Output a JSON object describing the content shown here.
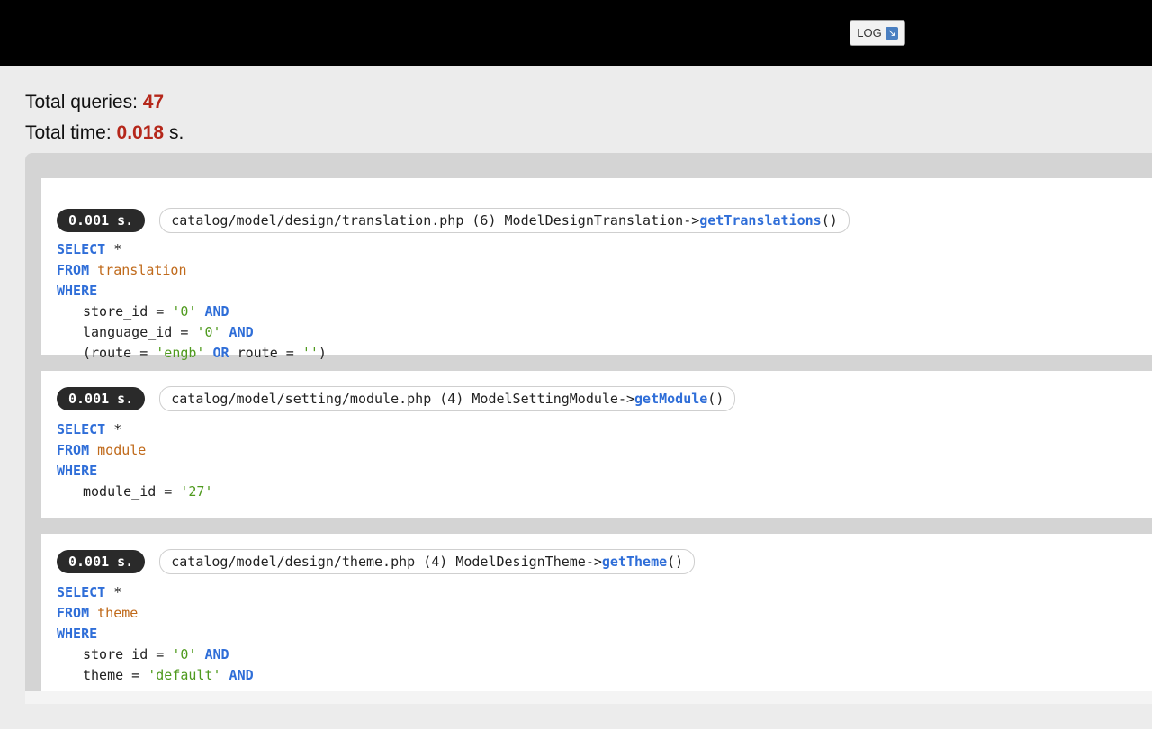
{
  "header": {
    "log_label": "LOG",
    "log_icon": "export-arrow-icon"
  },
  "stats": {
    "total_queries_label": "Total queries:",
    "total_queries_value": "47",
    "total_time_label": "Total time:",
    "total_time_value": "0.018",
    "total_time_unit": "s."
  },
  "queries": [
    {
      "time": "0.001 s.",
      "source": "catalog/model/design/translation.php (6) ModelDesignTranslation->",
      "method": "getTranslations",
      "parens": "()",
      "table": "translation",
      "conditions": [
        {
          "ident": "store_id = ",
          "value": "'0'",
          "kw": " AND"
        },
        {
          "ident": "language_id = ",
          "value": "'0'",
          "kw": " AND"
        },
        {
          "pre": "(route = ",
          "value1": "'engb'",
          "kw": " OR",
          "mid": " route = ",
          "value2": "''",
          "post": ")"
        }
      ]
    },
    {
      "time": "0.001 s.",
      "source": "catalog/model/setting/module.php (4) ModelSettingModule->",
      "method": "getModule",
      "parens": "()",
      "table": "module",
      "conditions": [
        {
          "ident": "module_id = ",
          "value": "'27'"
        }
      ]
    },
    {
      "time": "0.001 s.",
      "source": "catalog/model/design/theme.php (4) ModelDesignTheme->",
      "method": "getTheme",
      "parens": "()",
      "table": "theme",
      "conditions": [
        {
          "ident": "store_id = ",
          "value": "'0'",
          "kw": " AND"
        },
        {
          "ident": "theme = ",
          "value": "'default'",
          "kw": " AND"
        }
      ]
    }
  ],
  "sql_keywords": {
    "select": "SELECT",
    "star": " *",
    "from": "FROM ",
    "where": "WHERE"
  },
  "colors": {
    "keyword": "#2f6ed8",
    "table": "#c06a1b",
    "string": "#4f9a1e",
    "accent_value": "#b5271a"
  }
}
